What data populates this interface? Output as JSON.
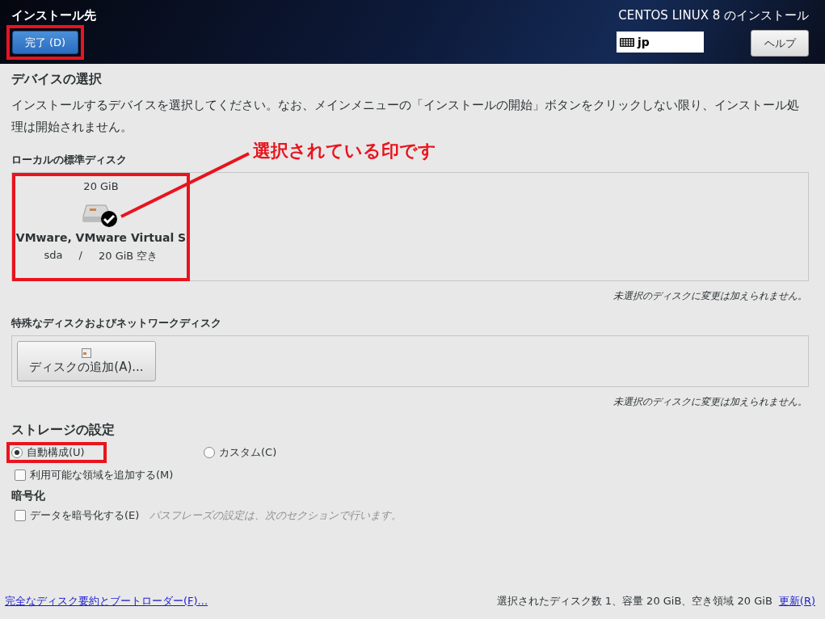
{
  "header": {
    "title": "インストール先",
    "done_button": {
      "label": "完了 (D)",
      "highlighted": true
    },
    "product": "CENTOS LINUX 8 のインストール",
    "keyboard": "jp",
    "help_button": "ヘルプ"
  },
  "device_selection": {
    "heading": "デバイスの選択",
    "description": "インストールするデバイスを選択してください。なお、メインメニューの「インストールの開始」ボタンをクリックしない限り、インストール処理は開始されません。",
    "local_disks": {
      "heading": "ローカルの標準ディスク",
      "disks": [
        {
          "size": "20 GiB",
          "name": "VMware, VMware Virtual S",
          "device": "sda",
          "separator": "/",
          "free": "20 GiB 空き",
          "selected": true,
          "highlighted": true
        }
      ],
      "note": "未選択のディスクに変更は加えられません。"
    },
    "special_disks": {
      "heading": "特殊なディスクおよびネットワークディスク",
      "add_button": "ディスクの追加(A)...",
      "note": "未選択のディスクに変更は加えられません。"
    }
  },
  "storage": {
    "heading": "ストレージの設定",
    "options": [
      {
        "label": "自動構成(U)",
        "selected": true,
        "highlighted": true
      },
      {
        "label": "カスタム(C)",
        "selected": false,
        "highlighted": false
      }
    ],
    "extra_space": {
      "label": "利用可能な領域を追加する(M)",
      "checked": false
    }
  },
  "encryption": {
    "heading": "暗号化",
    "checkbox": {
      "label": "データを暗号化する(E)",
      "checked": false
    },
    "hint": "パスフレーズの設定は、次のセクションで行います。"
  },
  "footer": {
    "summary_link": "完全なディスク要約とブートローダー(F)...",
    "status": "選択されたディスク数 1、容量 20 GiB、空き領域 20 GiB",
    "refresh_link": "更新(R)"
  },
  "annotation": {
    "label": "選択されている印です"
  }
}
